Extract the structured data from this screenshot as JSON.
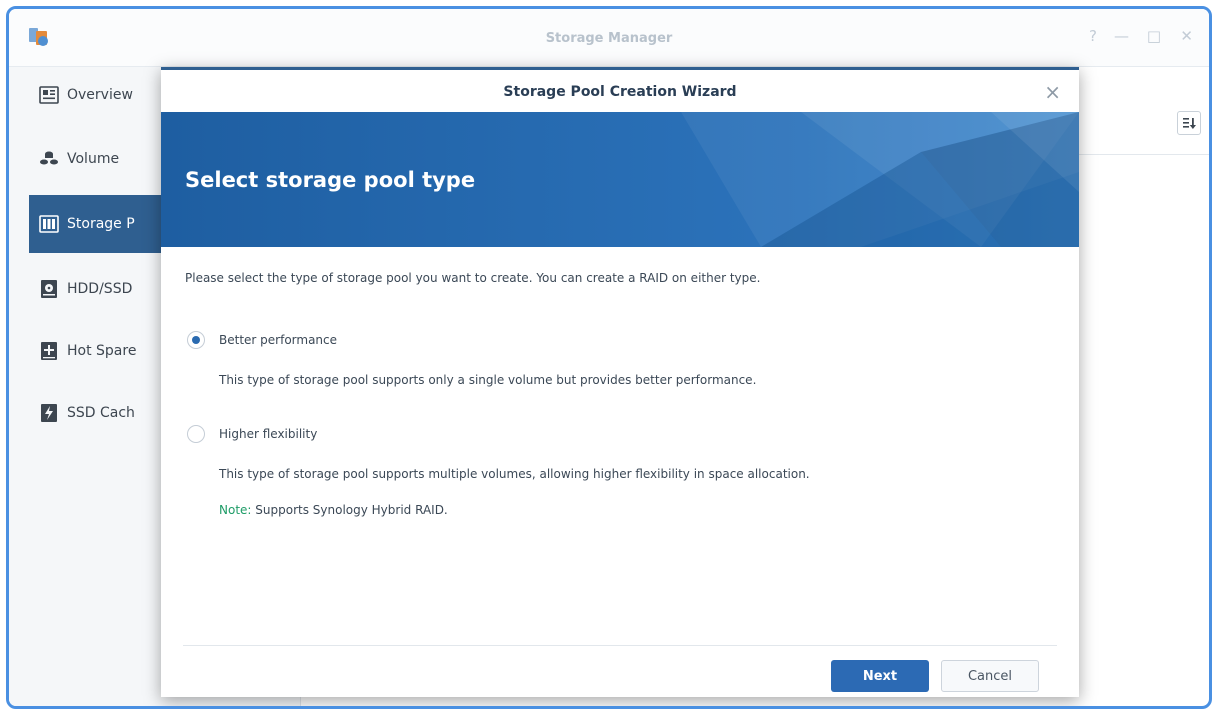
{
  "app": {
    "title": "Storage Manager",
    "window_controls": [
      "?",
      "—",
      "□",
      "✕"
    ]
  },
  "sidebar": {
    "items": [
      {
        "label": "Overview",
        "icon": "overview-icon",
        "active": false
      },
      {
        "label": "Volume",
        "icon": "volume-icon",
        "active": false
      },
      {
        "label": "Storage P",
        "icon": "storage-pool-icon",
        "active": true
      },
      {
        "label": "HDD/SSD",
        "icon": "hdd-icon",
        "active": false
      },
      {
        "label": "Hot Spare",
        "icon": "hot-spare-icon",
        "active": false
      },
      {
        "label": "SSD Cach",
        "icon": "ssd-cache-icon",
        "active": false
      }
    ]
  },
  "wizard": {
    "title": "Storage Pool Creation Wizard",
    "close": "×",
    "heading": "Select storage pool type",
    "intro": "Please select the type of storage pool you want to create. You can create a RAID on either type.",
    "options": [
      {
        "label": "Better performance",
        "selected": true,
        "description": "This type of storage pool supports only a single volume but provides better performance."
      },
      {
        "label": "Higher flexibility",
        "selected": false,
        "description": "This type of storage pool supports multiple volumes, allowing higher flexibility in space allocation."
      }
    ],
    "note_key": "Note:",
    "note_text": " Supports Synology Hybrid RAID.",
    "next_label": "Next",
    "cancel_label": "Cancel"
  },
  "colors": {
    "accent": "#2c6ab4",
    "sidebar_active": "#2f5f90",
    "note_green": "#1e9c67",
    "frame_border": "#4a90e2"
  }
}
